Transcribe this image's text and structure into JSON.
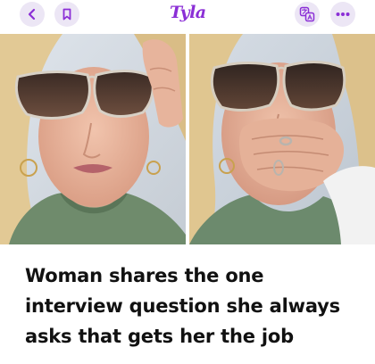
{
  "header": {
    "brand": "Tyla",
    "brand_color": "#8b2fd6",
    "button_bg": "#ece6f5",
    "icons": {
      "back": "chevron-left-icon",
      "bookmark": "bookmark-icon",
      "translate": "translate-icon",
      "more": "more-dots-icon"
    }
  },
  "hero": {
    "images": [
      {
        "name": "photo-woman-glasses-touching-frame"
      },
      {
        "name": "photo-woman-covering-mouth"
      }
    ]
  },
  "article": {
    "headline": "Woman shares the one interview question she always asks that gets her the job"
  }
}
